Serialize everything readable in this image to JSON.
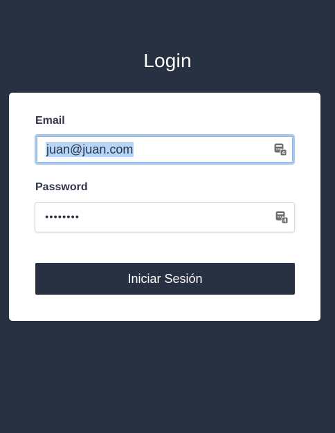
{
  "page": {
    "title": "Login"
  },
  "form": {
    "email_label": "Email",
    "email_value": "juan@juan.com",
    "password_label": "Password",
    "password_value_display": "••••••••",
    "submit_label": "Iniciar Sesión"
  },
  "icons": {
    "password_manager": "password-manager-icon"
  },
  "colors": {
    "background": "#283141",
    "card": "#ffffff",
    "focus_border": "#a9c9ec",
    "selection": "#b7d5f8"
  }
}
